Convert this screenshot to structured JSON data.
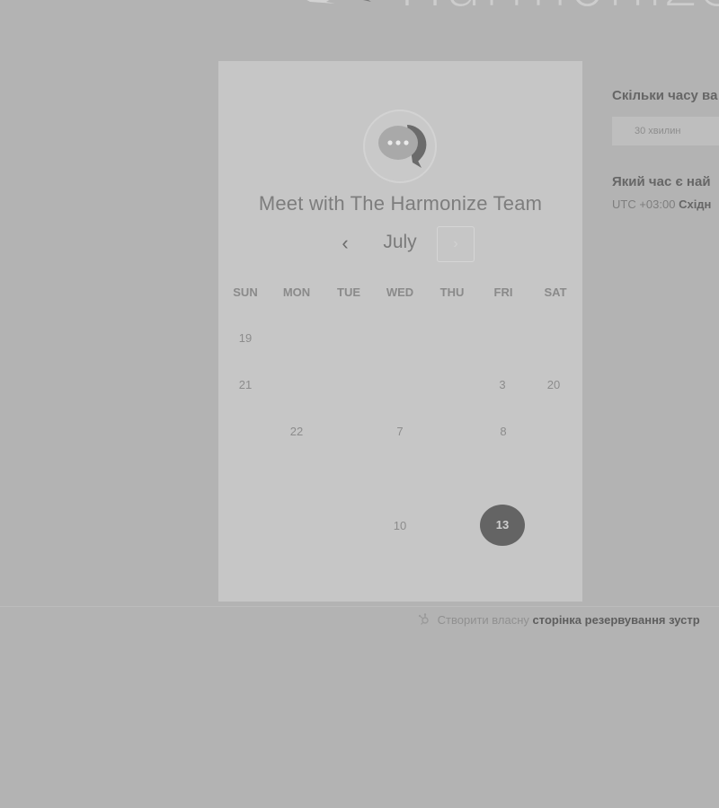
{
  "brand": {
    "logo_text": "Harmonize"
  },
  "card": {
    "title": "Meet with The Harmonize Team",
    "month": "July",
    "prev_icon": "‹",
    "next_icon": "›",
    "weekdays": [
      "SUN",
      "MON",
      "TUE",
      "WED",
      "THU",
      "FRI",
      "SAT"
    ],
    "days": [
      "19",
      "21",
      "3",
      "20",
      "22",
      "7",
      "8",
      "10",
      "13"
    ],
    "selected_day": "13"
  },
  "side": {
    "duration_label": "Скільки часу ва",
    "duration_value": "30 хвилин",
    "time_label": "Який час є най",
    "timezone_offset": "UTC +03:00",
    "timezone_name": "Східн"
  },
  "footer": {
    "prefix": "Створити власну",
    "link": "сторінка резервування зустр"
  },
  "colors": {
    "background": "#b3b3b3",
    "card": "#c6c6c6",
    "selected": "#646464"
  }
}
